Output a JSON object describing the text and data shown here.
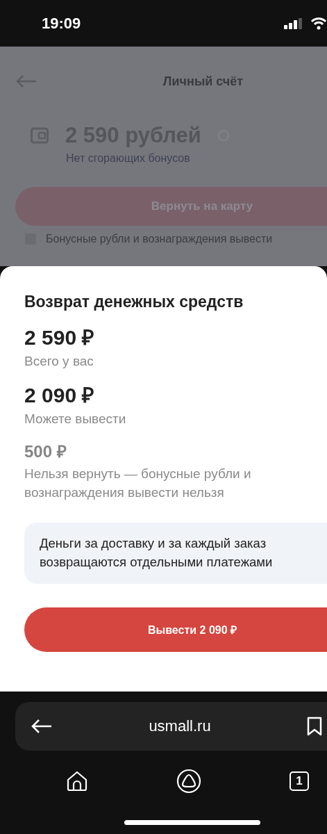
{
  "status_bar": {
    "time": "19:09"
  },
  "page": {
    "title": "Личный счёт",
    "balance": "2 590 рублей",
    "balance_note": "Нет сгорающих бонусов",
    "refund_button": "Вернуть на карту",
    "notice": "Бонусные рубли и вознаграждения вывести"
  },
  "sheet": {
    "title": "Возврат денежных средств",
    "amounts": [
      {
        "value": "2 590 ₽",
        "label": "Всего у вас",
        "kind": "primary"
      },
      {
        "value": "2 090 ₽",
        "label": "Можете вывести",
        "kind": "primary"
      },
      {
        "value": "500 ₽",
        "label": "Нельзя вернуть — бонусные рубли и вознаграждения вывести нельзя",
        "kind": "muted"
      }
    ],
    "info": "Деньги за доставку и за каждый заказ возвращаются отдельными платежами",
    "action_button": "Вывести 2 090 ₽"
  },
  "browser": {
    "url": "usmall.ru",
    "tab_count": "1"
  }
}
